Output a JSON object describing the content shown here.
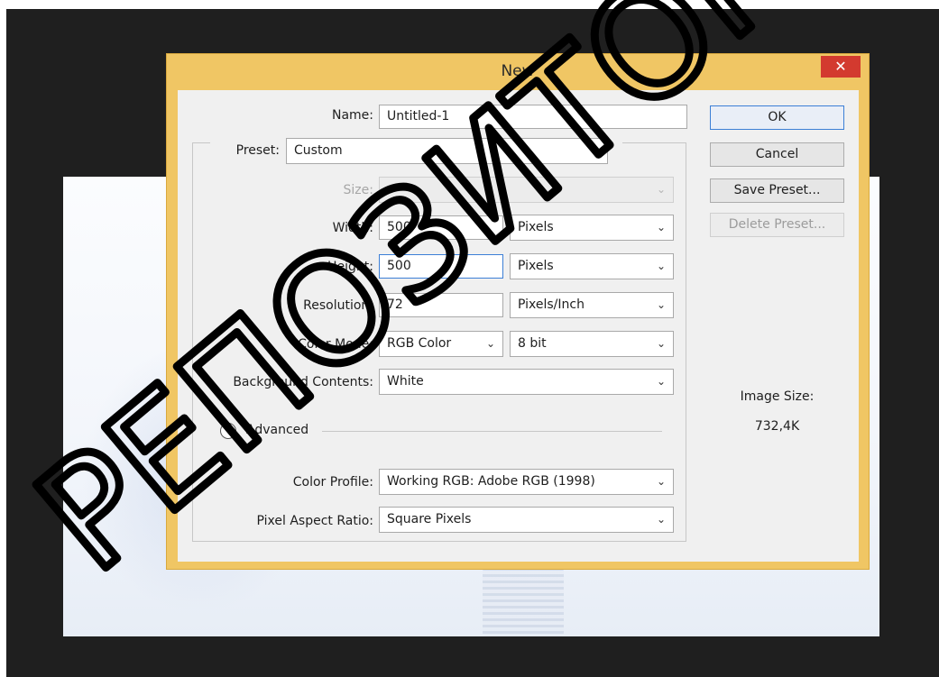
{
  "dialog": {
    "title": "New",
    "close_glyph": "✕"
  },
  "form": {
    "name_label": "Name:",
    "name_value": "Untitled-1",
    "preset_label": "Preset:",
    "preset_value": "Custom",
    "size_label": "Size:",
    "size_value": "",
    "width_label": "Width:",
    "width_value": "500",
    "width_unit": "Pixels",
    "height_label": "Height:",
    "height_value": "500",
    "height_unit": "Pixels",
    "resolution_label": "Resolution:",
    "resolution_value": "72",
    "resolution_unit": "Pixels/Inch",
    "color_mode_label": "Color Mode:",
    "color_mode_value": "RGB Color",
    "bit_depth_value": "8 bit",
    "background_label": "Background Contents:",
    "background_value": "White",
    "advanced_label": "Advanced",
    "color_profile_label": "Color Profile:",
    "color_profile_value": "Working RGB:  Adobe RGB (1998)",
    "pixel_aspect_label": "Pixel Aspect Ratio:",
    "pixel_aspect_value": "Square Pixels"
  },
  "buttons": {
    "ok": "OK",
    "cancel": "Cancel",
    "save_preset": "Save Preset...",
    "delete_preset": "Delete Preset..."
  },
  "info": {
    "image_size_label": "Image Size:",
    "image_size_value": "732,4K"
  },
  "watermark": {
    "text": "РЕПОЗИТОР"
  },
  "icons": {
    "dropdown": "chevron-down-icon",
    "advanced_toggle": "collapse-up-icon"
  },
  "colors": {
    "titlebar": "#f0c664",
    "close": "#d33a2f",
    "focus": "#3c7fd6"
  }
}
